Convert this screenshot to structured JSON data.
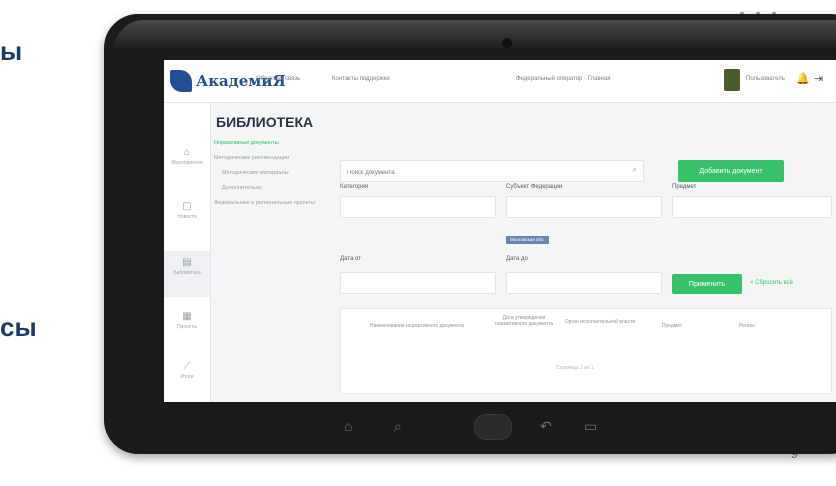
{
  "slide": {
    "heading_fragment_top": "ы",
    "heading_fragment_bottom": "сы",
    "page_number": "9",
    "dots": "• • •"
  },
  "app": {
    "logo_text": "АкадемиЯ",
    "header_links": [
      "Обратная связь",
      "Контакты поддержки",
      "Федеральный оператор · Главная"
    ],
    "user_name": "Пользователь",
    "icons": [
      "bell-icon",
      "logout-icon"
    ]
  },
  "rail": [
    {
      "icon": "home-icon",
      "label": "Мероприятия"
    },
    {
      "icon": "calendar-icon",
      "label": "Новости"
    },
    {
      "icon": "library-icon",
      "label": "Библиотека"
    },
    {
      "icon": "courses-icon",
      "label": "Проекты"
    },
    {
      "icon": "chart-icon",
      "label": "Итоги"
    }
  ],
  "tree": [
    {
      "label": "Нормативные документы",
      "selected": true
    },
    {
      "label": "Методические рекомендации",
      "selected": false
    },
    {
      "label": "Методические материалы",
      "selected": false,
      "sub": true
    },
    {
      "label": "Дополнительно",
      "selected": false,
      "sub": true
    },
    {
      "label": "Федеральные и региональные проекты",
      "selected": false
    }
  ],
  "main": {
    "title": "БИБЛИОТЕКА",
    "search_placeholder": "Поиск документа",
    "add_button": "Добавить документ",
    "filters": {
      "category_label": "Категория",
      "region_label": "Субъект Федерации",
      "subject_label": "Предмет",
      "date_from_label": "Дата от",
      "date_to_label": "Дата до",
      "chip": "Московская обл."
    },
    "apply_button": "Применить",
    "reset_link": "× Сбросить всё",
    "table_headers": [
      "Наименование нормативного документа",
      "Дата утверждения нормативного документа",
      "Орган исполнительной власти",
      "Предмет",
      "Регион"
    ],
    "pager": "Страница  1  из 1"
  }
}
